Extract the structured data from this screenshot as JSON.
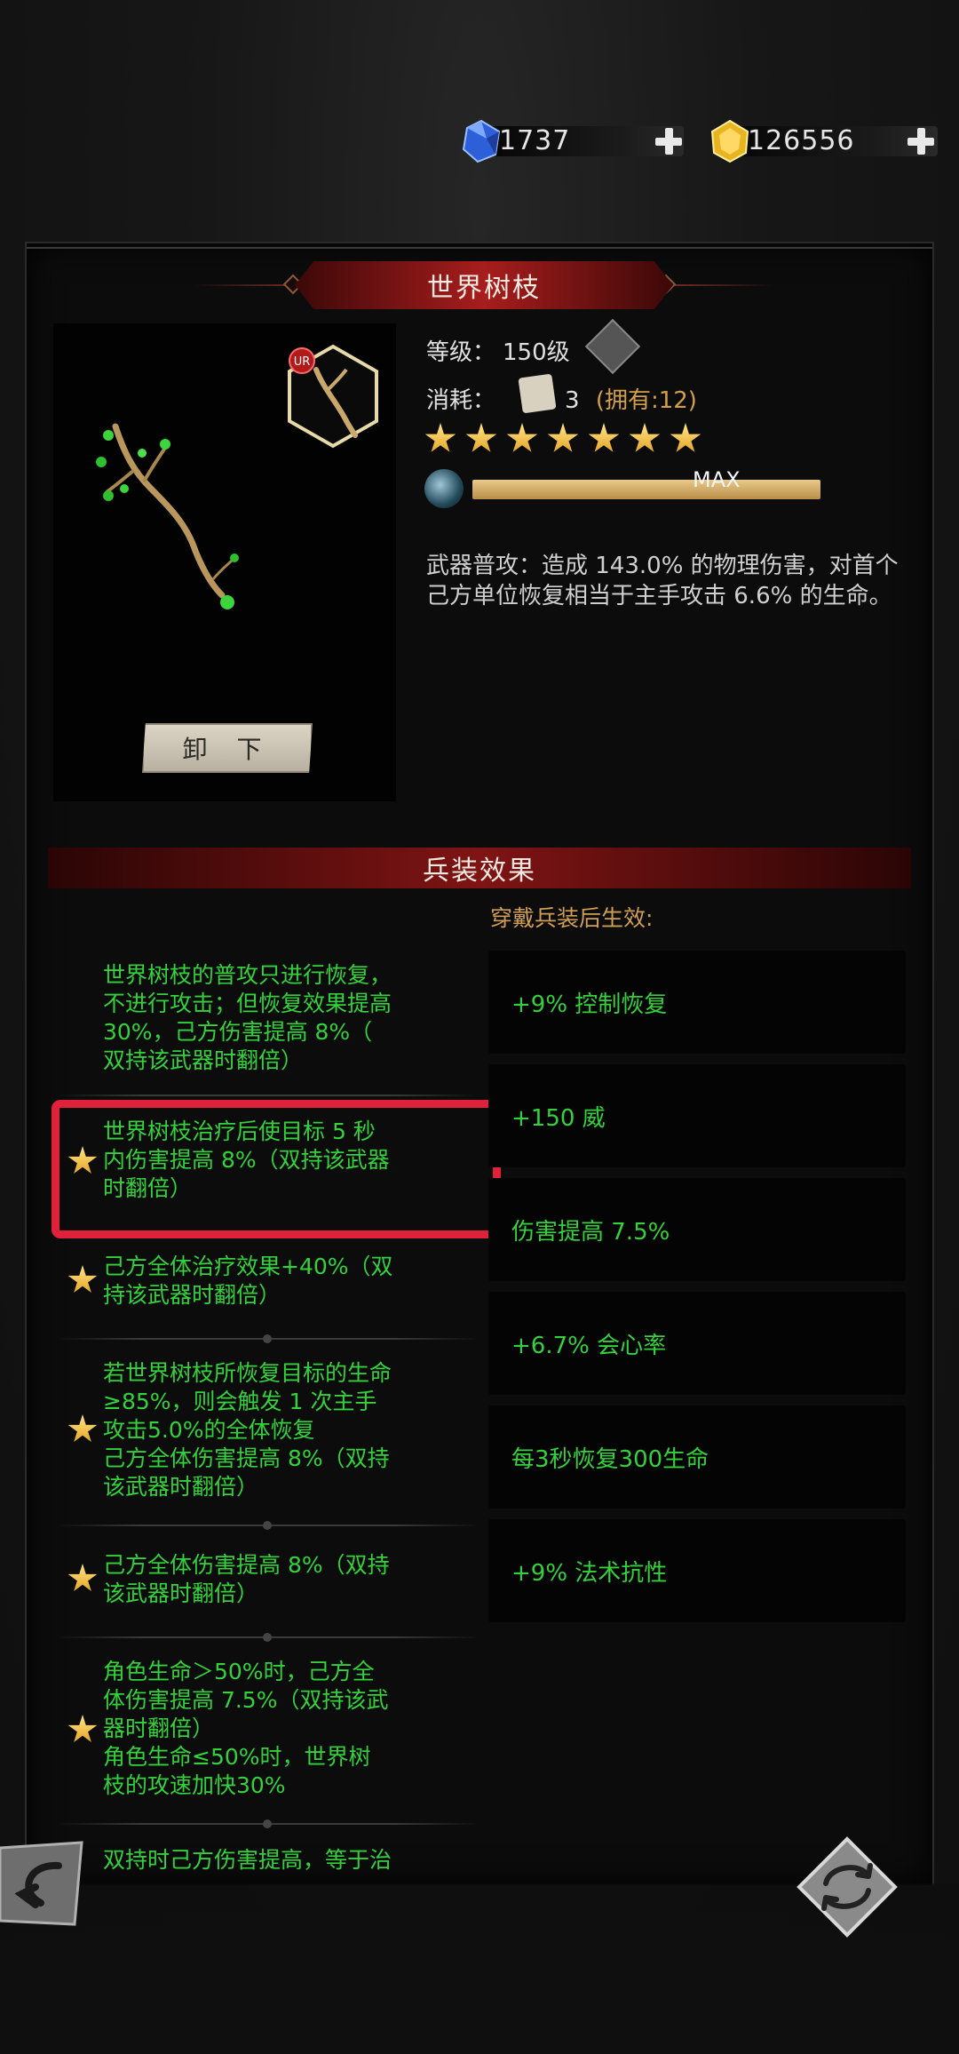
{
  "currency": {
    "gems": "1737",
    "gold": "126556"
  },
  "item": {
    "title": "世界树枝",
    "level_label": "等级：",
    "level_value": "150级",
    "cost_label": "消耗：",
    "cost_count": "3",
    "cost_owned": "(拥有:12)",
    "stars": 7,
    "exp_text": "MAX",
    "exp_progress": 1.0,
    "unload_label": "卸 下",
    "badge": "UR",
    "description": "武器普攻：造成 143.0% 的物理伤害，对首个己方单位恢复相当于主手攻击 6.6% 的生命。"
  },
  "effects": {
    "header": "兵装效果",
    "wear_note": "穿戴兵装后生效:",
    "list": [
      {
        "text_lines": [
          "世界树枝的普攻只进行恢复，",
          "不进行攻击；但恢复效果提高",
          "30%，己方伤害提高 8%（",
          "双持该武器时翻倍）"
        ],
        "starred": false
      },
      {
        "text_lines": [
          "世界树枝治疗后使目标 5 秒",
          "内伤害提高 8%（双持该武器",
          "时翻倍）"
        ],
        "starred": true
      },
      {
        "text_lines": [
          "己方全体治疗效果+40%（双",
          "持该武器时翻倍）"
        ],
        "starred": true
      },
      {
        "text_lines": [
          "若世界树枝所恢复目标的生命",
          "≥85%，则会触发 1 次主手",
          "攻击5.0%的全体恢复",
          "己方全体伤害提高 8%（双持",
          "该武器时翻倍）"
        ],
        "starred": true
      },
      {
        "text_lines": [
          "己方全体伤害提高 8%（双持",
          "该武器时翻倍）"
        ],
        "starred": true
      },
      {
        "text_lines": [
          "角色生命＞50%时，己方全",
          "体伤害提高 7.5%（双持该武",
          "器时翻倍）",
          "角色生命≤50%时，世界树",
          "枝的攻速加快30%"
        ],
        "starred": true
      },
      {
        "text_lines": [
          "双持时己方伤害提高，等于治"
        ],
        "starred": false
      }
    ],
    "stats": [
      "+9% 控制恢复",
      "+150 威",
      "伤害提高 7.5%",
      "+6.7% 会心率",
      "每3秒恢复300生命",
      "+9% 法术抗性"
    ]
  },
  "colors": {
    "effect_green": "#34d13c",
    "title_red": "#a81d1d",
    "highlight": "#e0213a",
    "owned_gold": "#d2a048"
  }
}
